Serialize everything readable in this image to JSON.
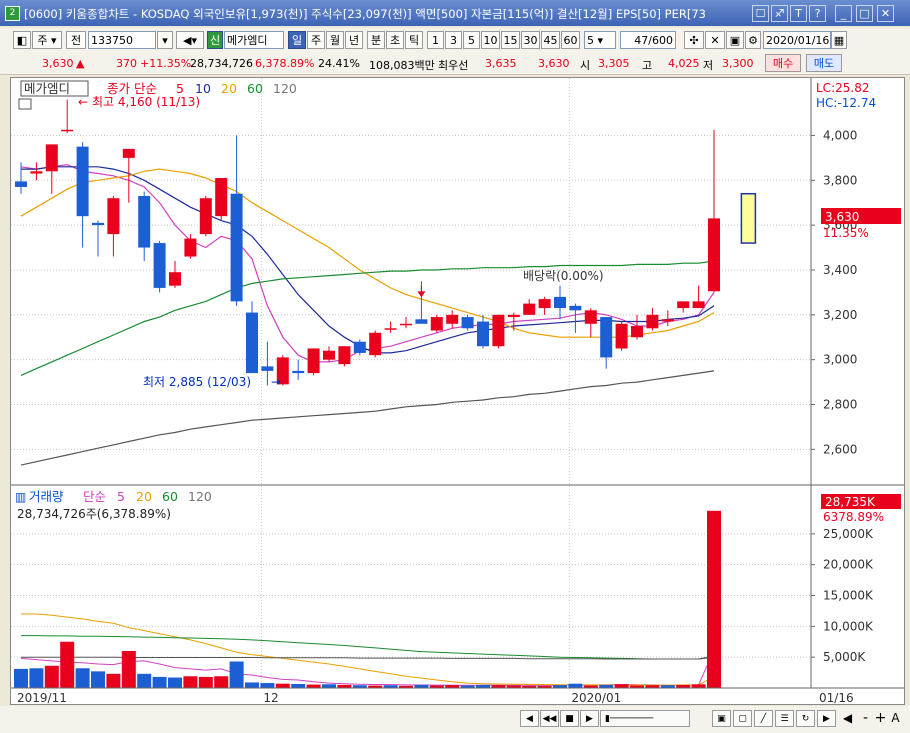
{
  "window": {
    "title": "[0600] 키움종합차트 - KOSDAQ 외국인보유[1,973(천)] 주식수[23,097(천)] 액면[500] 자본금[115(억)] 결산[12월] EPS[50] PER[73",
    "icon_label": "2",
    "title_buttons": [
      "☐",
      "♐",
      "T",
      "?",
      "_",
      "□",
      "✕"
    ]
  },
  "toolbar": {
    "market_type": "주",
    "prev_label": "전",
    "stock_code": "133750",
    "stock_badge": "신",
    "stock_name": "메가엠디",
    "periods": [
      "일",
      "주",
      "월",
      "년",
      "분",
      "초",
      "틱"
    ],
    "active_period": "일",
    "intervals": [
      "1",
      "3",
      "5",
      "10",
      "15",
      "30",
      "45",
      "60"
    ],
    "interval_value": "5",
    "count_value": "47",
    "count_total": "/600",
    "date_value": "2020/01/16"
  },
  "quote": {
    "price": "3,630",
    "arrow": "▲",
    "change": "370",
    "change_pct": "+11.35%",
    "volume": "28,734,726",
    "volume_ratio": "6,378.89%",
    "turnover": "24.41%",
    "amount": "108,083백만",
    "bid_label": "최우선",
    "bid1": "3,635",
    "bid2": "3,630",
    "open_label": "시",
    "open": "3,305",
    "high_label": "고",
    "high": "4,025",
    "low_label": "저",
    "low": "3,300",
    "buy_label": "매수",
    "sell_label": "매도"
  },
  "bottom": {
    "zoom_buttons": [
      "-",
      "+",
      "A"
    ]
  },
  "chart_data": {
    "type": "candlestick",
    "price_panel": {
      "legend_stock": "메가엠디",
      "legend_ma": [
        "종가 단순",
        "5",
        "10",
        "20",
        "60",
        "120"
      ],
      "ma_colors": [
        "#e8001c",
        "#d040c0",
        "#1c2a9a",
        "#e8a000",
        "#188c30",
        "#555555"
      ],
      "y_ticks": [
        "4,000",
        "3,800",
        "3,600",
        "3,400",
        "3,200",
        "3,000",
        "2,800",
        "2,600"
      ],
      "y_tick_values": [
        4000,
        3800,
        3600,
        3400,
        3200,
        3000,
        2800,
        2600
      ],
      "ylim": [
        2450,
        4100
      ],
      "lc_label": "LC:25.82",
      "hc_label": "HC:-12.74",
      "last_price_label": "3,630",
      "last_change_label": "11.35%",
      "annotations": {
        "high": "최고 4,160 (11/13)",
        "low": "최저 2,885 (12/03)",
        "dividend": "배당락(0.00%)"
      },
      "candles": [
        {
          "o": 3795,
          "h": 3880,
          "l": 3740,
          "c": 3770
        },
        {
          "o": 3830,
          "h": 3880,
          "l": 3800,
          "c": 3840
        },
        {
          "o": 3840,
          "h": 3960,
          "l": 3740,
          "c": 3960
        },
        {
          "o": 4025,
          "h": 4160,
          "l": 4010,
          "c": 4025
        },
        {
          "o": 3950,
          "h": 3970,
          "l": 3500,
          "c": 3640
        },
        {
          "o": 3610,
          "h": 3620,
          "l": 3460,
          "c": 3600
        },
        {
          "o": 3560,
          "h": 3730,
          "l": 3460,
          "c": 3720
        },
        {
          "o": 3900,
          "h": 3940,
          "l": 3700,
          "c": 3940
        },
        {
          "o": 3730,
          "h": 3750,
          "l": 3440,
          "c": 3500
        },
        {
          "o": 3520,
          "h": 3530,
          "l": 3300,
          "c": 3320
        },
        {
          "o": 3330,
          "h": 3440,
          "l": 3320,
          "c": 3390
        },
        {
          "o": 3460,
          "h": 3560,
          "l": 3450,
          "c": 3540
        },
        {
          "o": 3560,
          "h": 3730,
          "l": 3550,
          "c": 3720
        },
        {
          "o": 3640,
          "h": 3810,
          "l": 3620,
          "c": 3810
        },
        {
          "o": 3740,
          "h": 4000,
          "l": 3240,
          "c": 3260
        },
        {
          "o": 3210,
          "h": 3260,
          "l": 2960,
          "c": 2940
        },
        {
          "o": 2970,
          "h": 3080,
          "l": 2885,
          "c": 2950
        },
        {
          "o": 2890,
          "h": 3020,
          "l": 2885,
          "c": 3010
        },
        {
          "o": 2950,
          "h": 3000,
          "l": 2910,
          "c": 2940
        },
        {
          "o": 2940,
          "h": 3050,
          "l": 2930,
          "c": 3050
        },
        {
          "o": 3000,
          "h": 3060,
          "l": 2990,
          "c": 3040
        },
        {
          "o": 2980,
          "h": 3060,
          "l": 2970,
          "c": 3060
        },
        {
          "o": 3080,
          "h": 3090,
          "l": 3020,
          "c": 3030
        },
        {
          "o": 3020,
          "h": 3130,
          "l": 3010,
          "c": 3120
        },
        {
          "o": 3140,
          "h": 3170,
          "l": 3120,
          "c": 3140
        },
        {
          "o": 3160,
          "h": 3190,
          "l": 3140,
          "c": 3160
        },
        {
          "o": 3180,
          "h": 3350,
          "l": 3170,
          "c": 3160
        },
        {
          "o": 3130,
          "h": 3200,
          "l": 3120,
          "c": 3190
        },
        {
          "o": 3160,
          "h": 3220,
          "l": 3140,
          "c": 3200
        },
        {
          "o": 3190,
          "h": 3200,
          "l": 3130,
          "c": 3140
        },
        {
          "o": 3170,
          "h": 3200,
          "l": 3050,
          "c": 3060
        },
        {
          "o": 3060,
          "h": 3200,
          "l": 3050,
          "c": 3200
        },
        {
          "o": 3190,
          "h": 3210,
          "l": 3130,
          "c": 3200
        },
        {
          "o": 3200,
          "h": 3270,
          "l": 3200,
          "c": 3250
        },
        {
          "o": 3230,
          "h": 3280,
          "l": 3200,
          "c": 3270
        },
        {
          "o": 3280,
          "h": 3330,
          "l": 3180,
          "c": 3230
        },
        {
          "o": 3240,
          "h": 3250,
          "l": 3120,
          "c": 3220
        },
        {
          "o": 3160,
          "h": 3230,
          "l": 3100,
          "c": 3220
        },
        {
          "o": 3190,
          "h": 3190,
          "l": 2960,
          "c": 3010
        },
        {
          "o": 3050,
          "h": 3170,
          "l": 3040,
          "c": 3160
        },
        {
          "o": 3100,
          "h": 3200,
          "l": 3090,
          "c": 3150
        },
        {
          "o": 3140,
          "h": 3230,
          "l": 3130,
          "c": 3200
        },
        {
          "o": 3170,
          "h": 3220,
          "l": 3150,
          "c": 3180
        },
        {
          "o": 3230,
          "h": 3250,
          "l": 3210,
          "c": 3260
        },
        {
          "o": 3230,
          "h": 3330,
          "l": 3230,
          "c": 3260
        },
        {
          "o": 3305,
          "h": 4025,
          "l": 3300,
          "c": 3630
        }
      ],
      "ma": [
        {
          "name": "5",
          "values": [
            3860,
            3850,
            3860,
            3870,
            3840,
            3830,
            3820,
            3800,
            3770,
            3700,
            3600,
            3530,
            3500,
            3550,
            3530,
            3450,
            3240,
            3100,
            3020,
            2990,
            2990,
            3000,
            3040,
            3050,
            3060,
            3080,
            3100,
            3120,
            3140,
            3150,
            3155,
            3160,
            3170,
            3175,
            3180,
            3185,
            3200,
            3210,
            3200,
            3180,
            3150,
            3150,
            3170,
            3180,
            3200,
            3300
          ]
        },
        {
          "name": "10",
          "values": [
            3850,
            3850,
            3860,
            3860,
            3860,
            3860,
            3850,
            3830,
            3800,
            3760,
            3720,
            3680,
            3650,
            3620,
            3600,
            3550,
            3470,
            3380,
            3290,
            3220,
            3150,
            3100,
            3060,
            3030,
            3030,
            3040,
            3060,
            3080,
            3100,
            3120,
            3130,
            3140,
            3150,
            3155,
            3160,
            3165,
            3170,
            3175,
            3175,
            3170,
            3170,
            3170,
            3180,
            3185,
            3195,
            3240
          ]
        },
        {
          "name": "20",
          "values": [
            3640,
            3680,
            3720,
            3760,
            3790,
            3800,
            3810,
            3820,
            3840,
            3850,
            3840,
            3830,
            3810,
            3780,
            3750,
            3700,
            3660,
            3620,
            3580,
            3540,
            3500,
            3450,
            3400,
            3360,
            3320,
            3290,
            3270,
            3250,
            3230,
            3210,
            3190,
            3170,
            3140,
            3120,
            3110,
            3100,
            3100,
            3100,
            3100,
            3100,
            3110,
            3120,
            3130,
            3150,
            3170,
            3210
          ]
        },
        {
          "name": "60",
          "values": [
            2930,
            2960,
            2990,
            3020,
            3050,
            3080,
            3110,
            3140,
            3170,
            3190,
            3220,
            3240,
            3260,
            3290,
            3320,
            3340,
            3350,
            3360,
            3365,
            3370,
            3375,
            3380,
            3385,
            3390,
            3395,
            3395,
            3400,
            3400,
            3405,
            3405,
            3410,
            3410,
            3410,
            3415,
            3415,
            3420,
            3420,
            3420,
            3420,
            3420,
            3425,
            3425,
            3425,
            3430,
            3430,
            3440
          ]
        },
        {
          "name": "120",
          "values": [
            2530,
            2545,
            2560,
            2575,
            2590,
            2605,
            2620,
            2635,
            2650,
            2665,
            2675,
            2690,
            2700,
            2710,
            2720,
            2730,
            2735,
            2740,
            2745,
            2750,
            2755,
            2760,
            2765,
            2770,
            2780,
            2790,
            2795,
            2800,
            2810,
            2815,
            2820,
            2830,
            2835,
            2845,
            2850,
            2860,
            2870,
            2880,
            2885,
            2895,
            2900,
            2910,
            2920,
            2930,
            2940,
            2950
          ]
        }
      ]
    },
    "volume_panel": {
      "legend": [
        "거래량",
        "단순",
        "5",
        "20",
        "60",
        "120"
      ],
      "info_line": "28,734,726주(6,378.89%)",
      "y_ticks": [
        "25,000K",
        "20,000K",
        "15,000K",
        "10,000K",
        "5,000K"
      ],
      "y_tick_values": [
        25000,
        20000,
        15000,
        10000,
        5000
      ],
      "ylim": [
        0,
        30000
      ],
      "last_volume_label": "28,735K",
      "last_ratio_label": "6378.89%",
      "values": [
        3100,
        3200,
        3600,
        7500,
        3200,
        2700,
        2300,
        6000,
        2300,
        1800,
        1700,
        1900,
        1800,
        1900,
        4300,
        900,
        800,
        700,
        650,
        550,
        600,
        500,
        450,
        400,
        450,
        350,
        500,
        400,
        450,
        400,
        500,
        450,
        400,
        350,
        350,
        450,
        700,
        400,
        500,
        600,
        400,
        450,
        450,
        500,
        600,
        28735
      ],
      "up": [
        false,
        false,
        true,
        true,
        false,
        false,
        true,
        true,
        false,
        false,
        false,
        true,
        true,
        true,
        false,
        false,
        false,
        true,
        false,
        true,
        false,
        true,
        false,
        true,
        false,
        true,
        false,
        true,
        true,
        false,
        false,
        true,
        true,
        true,
        true,
        false,
        false,
        true,
        false,
        true,
        true,
        true,
        false,
        true,
        true,
        true
      ],
      "ma": [
        {
          "name": "5",
          "values": [
            4800,
            4600,
            4400,
            4200,
            4100,
            3900,
            3800,
            4300,
            4400,
            3900,
            3300,
            3100,
            2900,
            3100,
            2300,
            2100,
            1700,
            1400,
            1300,
            1000,
            800,
            700,
            600,
            560,
            550,
            500,
            480,
            470,
            460,
            450,
            450,
            440,
            430,
            430,
            430,
            440,
            470,
            480,
            500,
            560,
            540,
            500,
            460,
            470,
            500,
            6200
          ]
        },
        {
          "name": "20",
          "values": [
            12000,
            12000,
            11800,
            11500,
            11200,
            10800,
            10500,
            9800,
            9300,
            8800,
            8300,
            7800,
            7200,
            6500,
            5800,
            5400,
            5100,
            4800,
            4500,
            4200,
            3900,
            3500,
            3100,
            2700,
            2300,
            1900,
            1600,
            1300,
            1000,
            800,
            700,
            650,
            600,
            580,
            560,
            540,
            520,
            510,
            500,
            490,
            480,
            470,
            470,
            480,
            490,
            1900
          ]
        },
        {
          "name": "60",
          "values": [
            8500,
            8500,
            8450,
            8450,
            8400,
            8400,
            8350,
            8300,
            8250,
            8200,
            8150,
            8100,
            8050,
            8000,
            7900,
            7800,
            7650,
            7500,
            7350,
            7200,
            7050,
            6900,
            6700,
            6500,
            6300,
            6100,
            5900,
            5800,
            5700,
            5600,
            5500,
            5400,
            5300,
            5200,
            5100,
            5000,
            4950,
            4900,
            4850,
            4800,
            4750,
            4700,
            4700,
            4700,
            4700,
            5200
          ]
        },
        {
          "name": "120",
          "values": [
            5000,
            5000,
            5000,
            5000,
            5000,
            5000,
            5000,
            4950,
            4950,
            4950,
            4950,
            4950,
            4950,
            4950,
            4950,
            4950,
            4900,
            4900,
            4900,
            4900,
            4900,
            4900,
            4850,
            4850,
            4850,
            4850,
            4850,
            4850,
            4800,
            4800,
            4800,
            4800,
            4800,
            4750,
            4750,
            4750,
            4750,
            4750,
            4700,
            4700,
            4700,
            4700,
            4700,
            4700,
            4700,
            5000
          ]
        }
      ]
    },
    "x_axis": {
      "labels": [
        "2019/11",
        "12",
        "2020/01",
        "01/16"
      ],
      "label_index": [
        0,
        16,
        36,
        46
      ]
    }
  }
}
